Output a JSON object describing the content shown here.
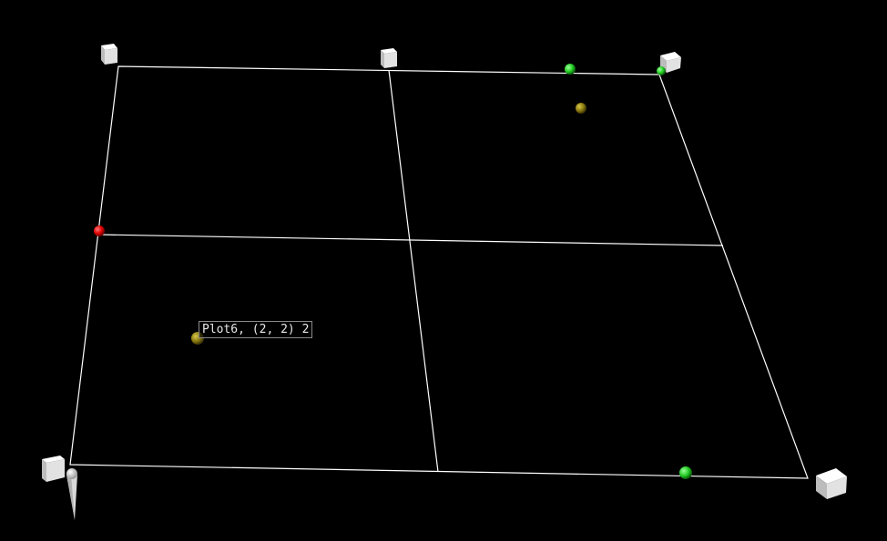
{
  "scene": {
    "background_color": "#000000",
    "grid_color": "#ffffff",
    "tooltip": {
      "text": "Plot6, (2, 2) 2"
    },
    "markers": [
      {
        "name": "red-sphere",
        "color": "#e00000"
      },
      {
        "name": "green-sphere",
        "color": "#22cc22"
      },
      {
        "name": "olive-sphere",
        "color": "#8a7a10"
      },
      {
        "name": "white-cube",
        "color": "#e6e6e6"
      }
    ]
  }
}
